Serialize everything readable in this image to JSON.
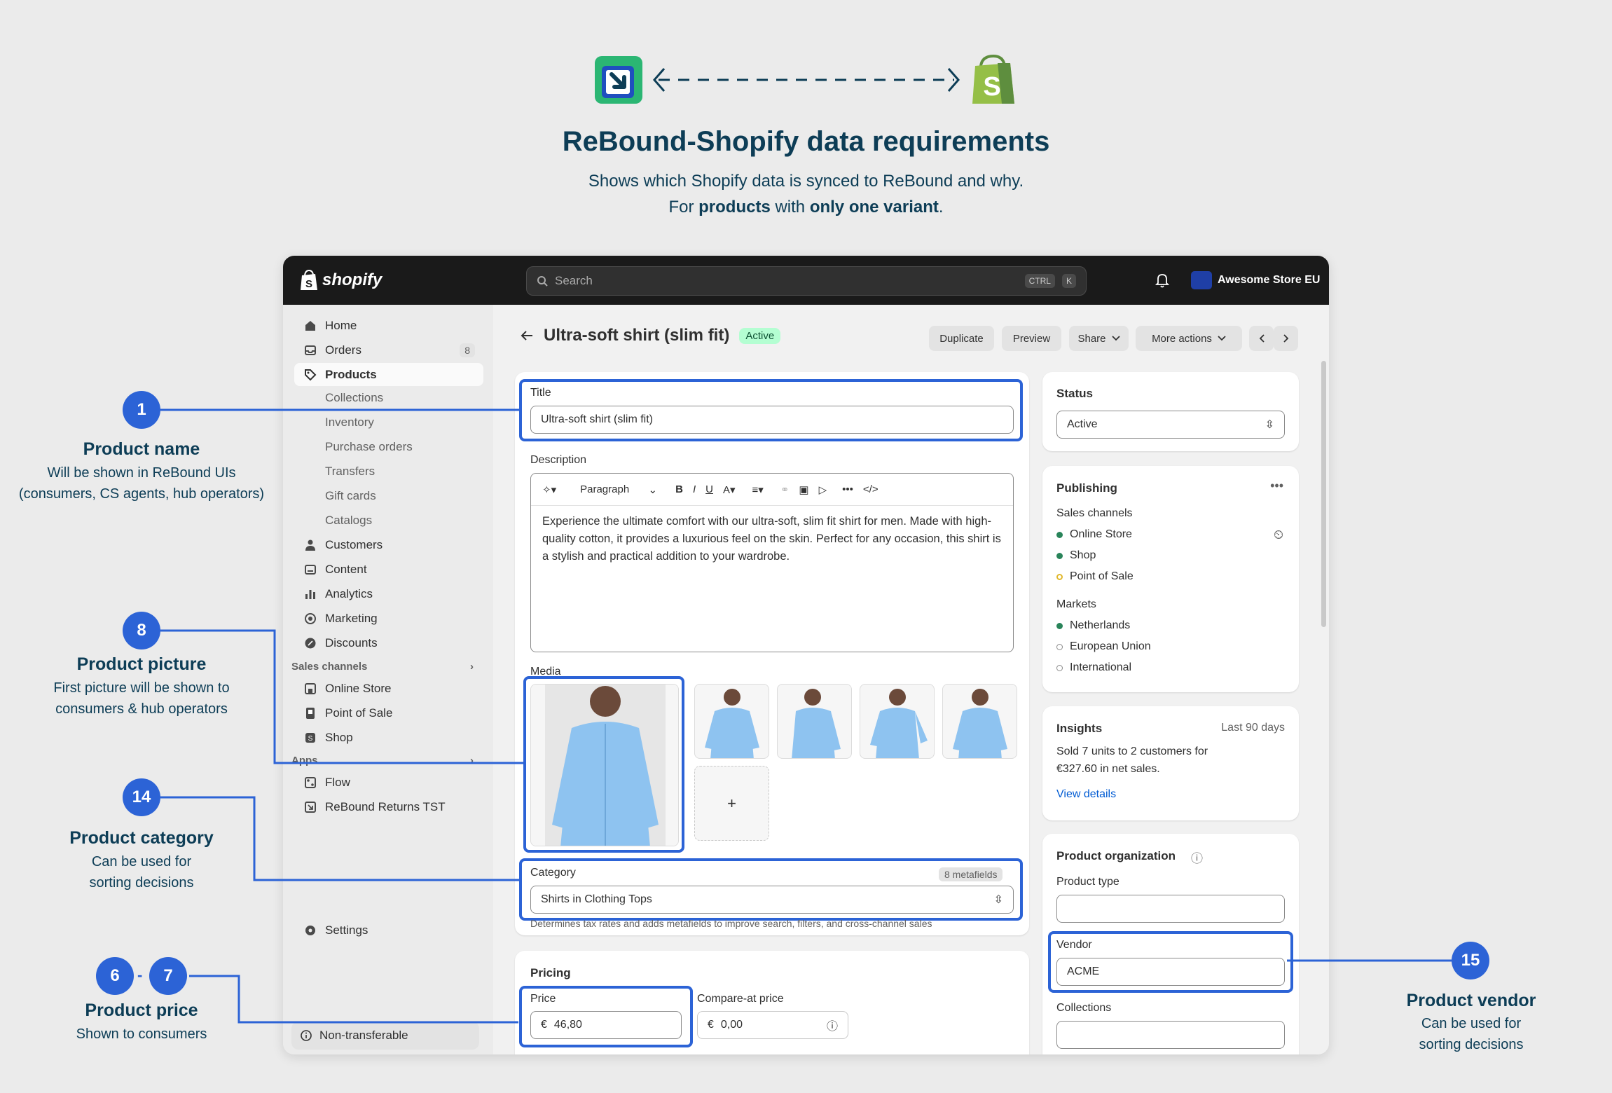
{
  "header": {
    "title": "ReBound-Shopify data requirements",
    "subtitle_line1": "Shows which Shopify data is synced to ReBound and why.",
    "subtitle_line2_pre": "For ",
    "subtitle_line2_b1": "products",
    "subtitle_line2_mid": " with ",
    "subtitle_line2_b2": "only one variant",
    "subtitle_line2_post": "."
  },
  "annotations": {
    "a1": {
      "badge": "1",
      "title": "Product name",
      "desc1": "Will be shown in ReBound UIs",
      "desc2": "(consumers, CS agents, hub operators)"
    },
    "a8": {
      "badge": "8",
      "title": "Product picture",
      "desc1": "First picture will be shown to",
      "desc2": "consumers & hub operators"
    },
    "a14": {
      "badge": "14",
      "title": "Product category",
      "desc1": "Can be used for",
      "desc2": "sorting decisions"
    },
    "a6": {
      "badge": "6",
      "badge2": "7",
      "sep": "-",
      "title": "Product price",
      "desc1": "Shown to consumers"
    },
    "a15": {
      "badge": "15",
      "title": "Product vendor",
      "desc1": "Can be used for",
      "desc2": "sorting decisions"
    }
  },
  "topbar": {
    "brand": "shopify",
    "search_placeholder": "Search",
    "kbd1": "CTRL",
    "kbd2": "K",
    "store_name": "Awesome Store EU"
  },
  "sidebar": {
    "items": [
      {
        "label": "Home"
      },
      {
        "label": "Orders",
        "count": "8"
      },
      {
        "label": "Products"
      }
    ],
    "product_subitems": [
      "Collections",
      "Inventory",
      "Purchase orders",
      "Transfers",
      "Gift cards",
      "Catalogs"
    ],
    "items2": [
      {
        "label": "Customers"
      },
      {
        "label": "Content"
      },
      {
        "label": "Analytics"
      },
      {
        "label": "Marketing"
      },
      {
        "label": "Discounts"
      }
    ],
    "sales_channels_label": "Sales channels",
    "sales_channels": [
      "Online Store",
      "Point of Sale",
      "Shop"
    ],
    "apps_label": "Apps",
    "apps": [
      "Flow",
      "ReBound Returns TST"
    ],
    "settings": "Settings",
    "non_transferable": "Non-transferable"
  },
  "page": {
    "title": "Ultra-soft shirt (slim fit)",
    "status_badge": "Active",
    "buttons": {
      "duplicate": "Duplicate",
      "preview": "Preview",
      "share": "Share",
      "more": "More actions"
    }
  },
  "product": {
    "title_label": "Title",
    "title_value": "Ultra-soft shirt (slim fit)",
    "description_label": "Description",
    "paragraph_select": "Paragraph",
    "description": "Experience the ultimate comfort with our ultra-soft, slim fit shirt for men. Made with high-quality cotton, it provides a luxurious feel on the skin. Perfect for any occasion, this shirt is a stylish and practical addition to your wardrobe.",
    "media_label": "Media",
    "add_media": "+",
    "category_label": "Category",
    "metafields": "8 metafields",
    "category_value": "Shirts in Clothing Tops",
    "category_help": "Determines tax rates and adds metafields to improve search, filters, and cross-channel sales",
    "pricing_label": "Pricing",
    "price_label": "Price",
    "price_currency": "€",
    "price_value": "46,80",
    "compare_label": "Compare-at price",
    "compare_currency": "€",
    "compare_value": "0,00"
  },
  "right": {
    "status_label": "Status",
    "status_value": "Active",
    "publishing_label": "Publishing",
    "sales_channels_label": "Sales channels",
    "channels": [
      {
        "name": "Online Store",
        "state": "active"
      },
      {
        "name": "Shop",
        "state": "active"
      },
      {
        "name": "Point of Sale",
        "state": "pending"
      }
    ],
    "markets_label": "Markets",
    "markets": [
      {
        "name": "Netherlands",
        "state": "active"
      },
      {
        "name": "European Union",
        "state": "inactive"
      },
      {
        "name": "International",
        "state": "inactive"
      }
    ],
    "insights_label": "Insights",
    "insights_period": "Last 90 days",
    "insights_line1": "Sold 7 units to 2 customers for",
    "insights_line2": "€327.60 in net sales.",
    "view_details": "View details",
    "org_label": "Product organization",
    "product_type_label": "Product type",
    "product_type_value": "",
    "vendor_label": "Vendor",
    "vendor_value": "ACME",
    "collections_label": "Collections"
  },
  "colors": {
    "accent": "#2c63d6",
    "navy": "#0d3d56",
    "active_green": "#29845a",
    "shopify_green": "#95bf47"
  }
}
